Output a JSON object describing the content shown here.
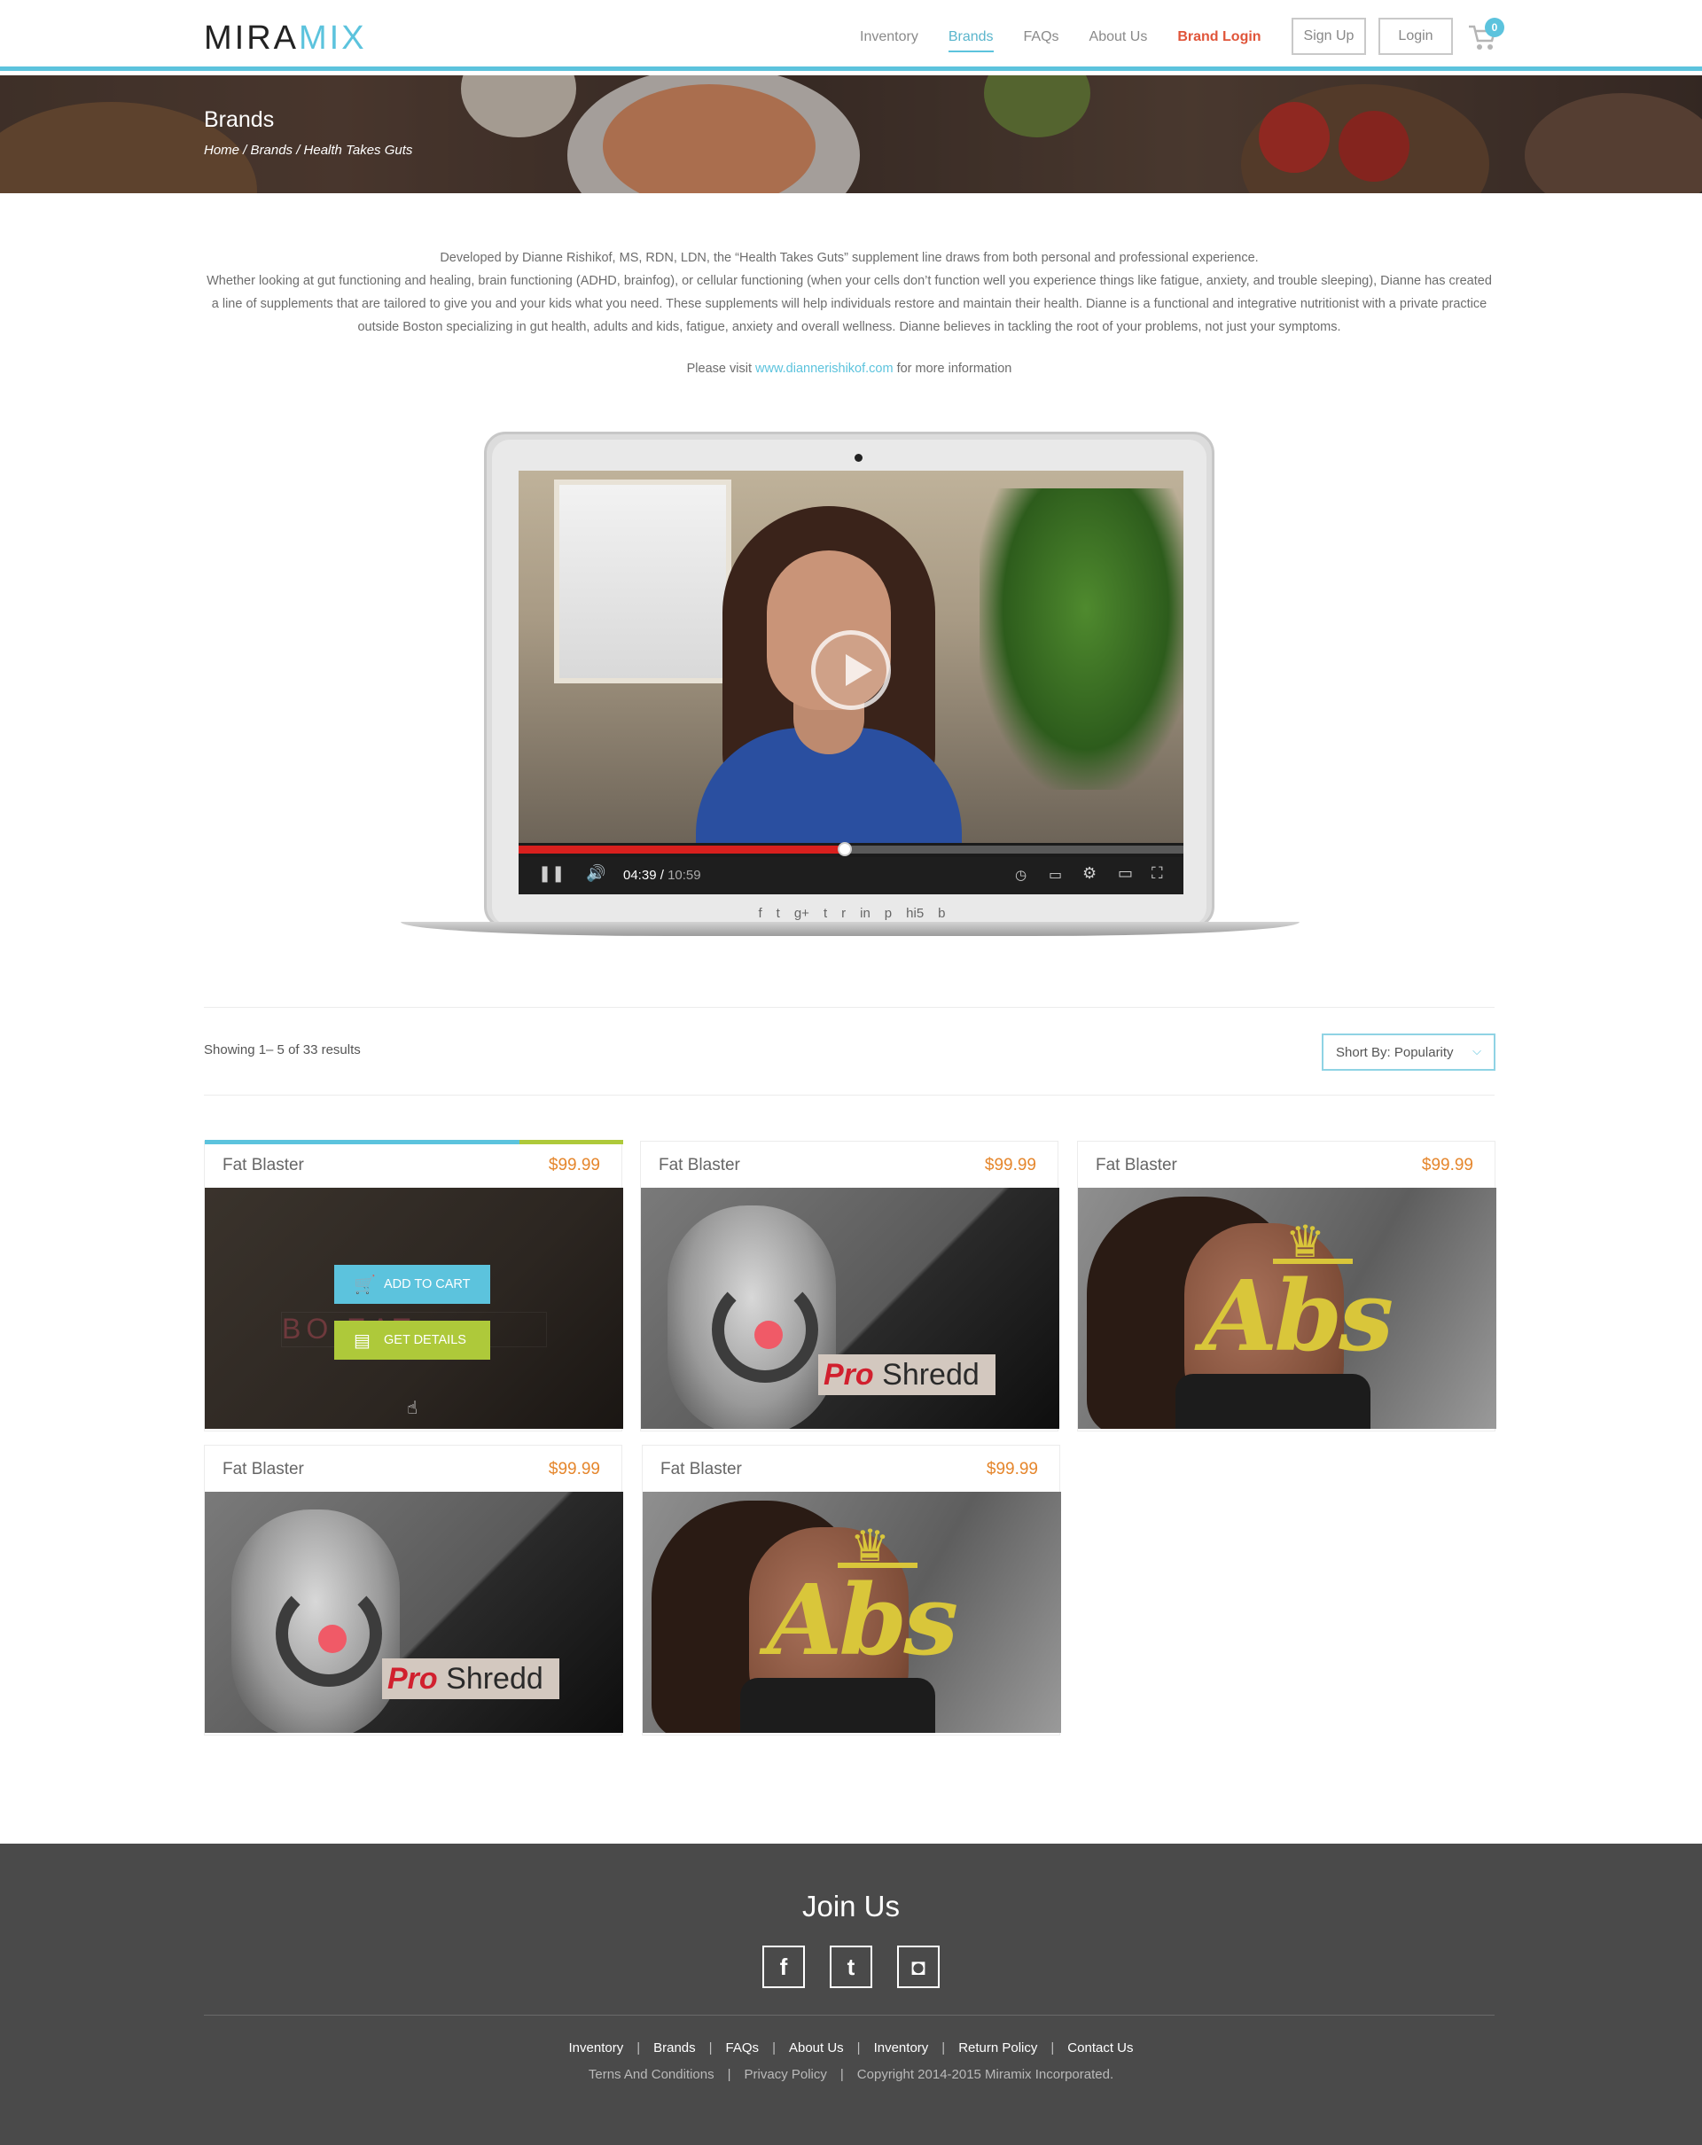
{
  "header": {
    "logo_mira": "MIRA",
    "logo_mix": "MIX",
    "nav": [
      {
        "label": "Inventory"
      },
      {
        "label": "Brands"
      },
      {
        "label": "FAQs"
      },
      {
        "label": "About Us"
      },
      {
        "label": "Brand Login"
      }
    ],
    "signup_label": "Sign Up",
    "login_label": "Login",
    "cart_count": "0",
    "accent_color": "#5cc3dd"
  },
  "hero": {
    "title": "Brands",
    "breadcrumb": "Home / Brands / Health Takes Guts"
  },
  "intro": {
    "line1": "Developed by Dianne Rishikof, MS, RDN, LDN, the “Health Takes Guts” supplement line draws from both personal and professional experience.",
    "line2": "Whether looking at gut functioning and healing, brain functioning (ADHD, brainfog), or cellular functioning (when your cells don’t function well you experience things like fatigue, anxiety, and trouble sleeping), Dianne has created a line of supplements that are tailored to give you and your kids what you need. These supplements will help individuals restore and maintain their health. Dianne is a functional and integrative nutritionist with a private practice outside Boston specializing in gut health, adults and kids, fatigue, anxiety and overall wellness. Dianne believes in tackling the root of your problems, not just your symptoms.",
    "visit_prefix": "Please visit",
    "visit_link": "www.diannerishikof.com",
    "visit_suffix": "for more information"
  },
  "video": {
    "current_time": "04:39",
    "duration": "10:59",
    "progress_fraction": 0.49,
    "share_icons": [
      "facebook-icon",
      "twitter-icon",
      "google-plus-icon",
      "tumblr-icon",
      "reddit-icon",
      "linkedin-icon",
      "pinterest-icon",
      "hi5-icon",
      "blogger-icon"
    ],
    "share_glyphs": [
      "f",
      "t",
      "g+",
      "t",
      "r",
      "in",
      "p",
      "hi5",
      "b"
    ]
  },
  "results": {
    "showing": "Showing 1– 5 of 33 results",
    "sort_label": "Short By: Popularity"
  },
  "products": [
    {
      "name": "Fat Blaster",
      "price": "$99.99",
      "image": "fitness-woman",
      "hover": true
    },
    {
      "name": "Fat Blaster",
      "price": "$99.99",
      "image": "pro-shredd"
    },
    {
      "name": "Fat Blaster",
      "price": "$99.99",
      "image": "abs"
    },
    {
      "name": "Fat Blaster",
      "price": "$99.99",
      "image": "pro-shredd"
    },
    {
      "name": "Fat Blaster",
      "price": "$99.99",
      "image": "abs"
    }
  ],
  "product_overlay": {
    "add_to_cart": "ADD TO CART",
    "get_details": "GET DETAILS",
    "bg_text": "BO        EAT"
  },
  "product_art": {
    "pro": "Pro",
    "shredd": "Shredd",
    "abs": "Abs"
  },
  "footer": {
    "join_title": "Join Us",
    "socials": [
      "facebook-icon",
      "twitter-icon",
      "instagram-icon"
    ],
    "social_glyphs": [
      "f",
      "t",
      "◘"
    ],
    "links": [
      "Inventory",
      "Brands",
      "FAQs",
      "About Us",
      "Inventory",
      "Return Policy",
      "Contact Us"
    ],
    "legal": [
      "Terns And Conditions",
      "Privacy Policy",
      "Copyright 2014-2015 Miramix Incorporated."
    ],
    "background": "#4a4a4a"
  }
}
